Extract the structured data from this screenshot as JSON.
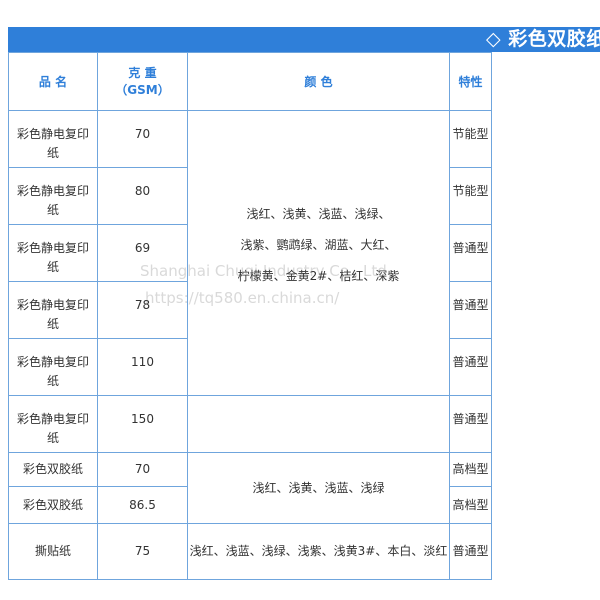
{
  "banner": {
    "title": "◇ 彩色双胶纸"
  },
  "headers": {
    "name": "品 名",
    "weight_line1": "克 重",
    "weight_line2": "（GSM）",
    "color": "颜 色",
    "feature": "特性"
  },
  "rows": [
    {
      "name": "彩色静电复印纸",
      "gsm": "70",
      "feature": "节能型"
    },
    {
      "name": "彩色静电复印纸",
      "gsm": "80",
      "feature": "节能型"
    },
    {
      "name": "彩色静电复印纸",
      "gsm": "69",
      "feature": "普通型"
    },
    {
      "name": "彩色静电复印纸",
      "gsm": "78",
      "feature": "普通型"
    },
    {
      "name": "彩色静电复印纸",
      "gsm": "110",
      "feature": "普通型"
    },
    {
      "name": "彩色静电复印纸",
      "gsm": "150",
      "feature": "普通型"
    },
    {
      "name": "彩色双胶纸",
      "gsm": "70",
      "feature": "高档型"
    },
    {
      "name": "彩色双胶纸",
      "gsm": "86.5",
      "feature": "高档型"
    },
    {
      "name": "撕贴纸",
      "gsm": "75",
      "feature": "普通型"
    }
  ],
  "colors": {
    "group1_line1": "浅红、浅黄、浅蓝、浅绿、",
    "group1_line2": "浅紫、鹦鹉绿、湖蓝、大红、",
    "group1_line3": "柠檬黄、金黄2#、桔红、深紫",
    "group2": "浅红、浅黄、浅蓝、浅绿",
    "group3": "浅红、浅蓝、浅绿、浅紫、浅黄3#、本白、淡红"
  },
  "watermark": {
    "line1": "Shanghai Chuqi Industry Co., Ltd",
    "line2": "https://tq580.en.china.cn/"
  }
}
